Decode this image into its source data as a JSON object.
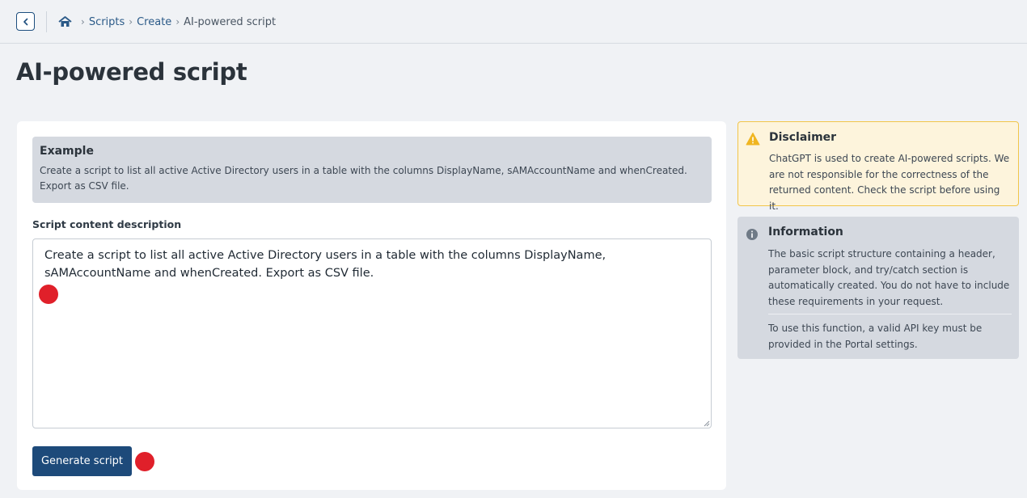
{
  "breadcrumb": {
    "items": [
      "Scripts",
      "Create",
      "AI-powered script"
    ]
  },
  "page": {
    "title": "AI-powered script"
  },
  "example": {
    "title": "Example",
    "text": "Create a script to list all active Active Directory users in a table with the columns DisplayName, sAMAccountName and whenCreated. Export as CSV file."
  },
  "form": {
    "description_label": "Script content description",
    "description_value": "Create a script to list all active Active Directory users in a table with the columns DisplayName, sAMAccountName and whenCreated. Export as CSV file.",
    "generate_label": "Generate script"
  },
  "disclaimer": {
    "title": "Disclaimer",
    "text": "ChatGPT is used to create AI-powered scripts. We are not responsible for the correctness of the returned content. Check the script before using it."
  },
  "information": {
    "title": "Information",
    "text": "The basic script structure containing a header, parameter block, and try/catch section is automatically created. You do not have to include these requirements in your request.",
    "text2": "To use this function, a valid API key must be provided in the Portal settings."
  },
  "icons": {
    "back": "chevron-left-icon",
    "home": "home-icon",
    "warning": "warning-icon",
    "info": "info-icon"
  },
  "colors": {
    "primary": "#1d4a7a",
    "marker": "#e0202a",
    "warning_bg": "#fdf4dc",
    "warning_border": "#f1c54a"
  }
}
